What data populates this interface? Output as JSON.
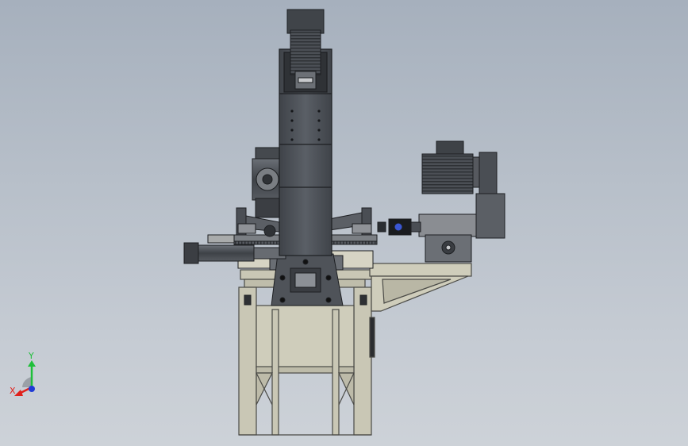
{
  "colors": {
    "background_top": "#a6b0bd",
    "background_bottom": "#cdd2d8",
    "frame": "#c9c7b5",
    "frame_edge": "#4a4a46",
    "column": "#4c5056",
    "column_light": "#61666d",
    "motor": "#5a5e64",
    "axis_x": "#e0211c",
    "axis_y": "#1fbf3a",
    "axis_z": "#1f3bd6"
  },
  "triad": {
    "x_label": "X",
    "y_label": "Y"
  }
}
